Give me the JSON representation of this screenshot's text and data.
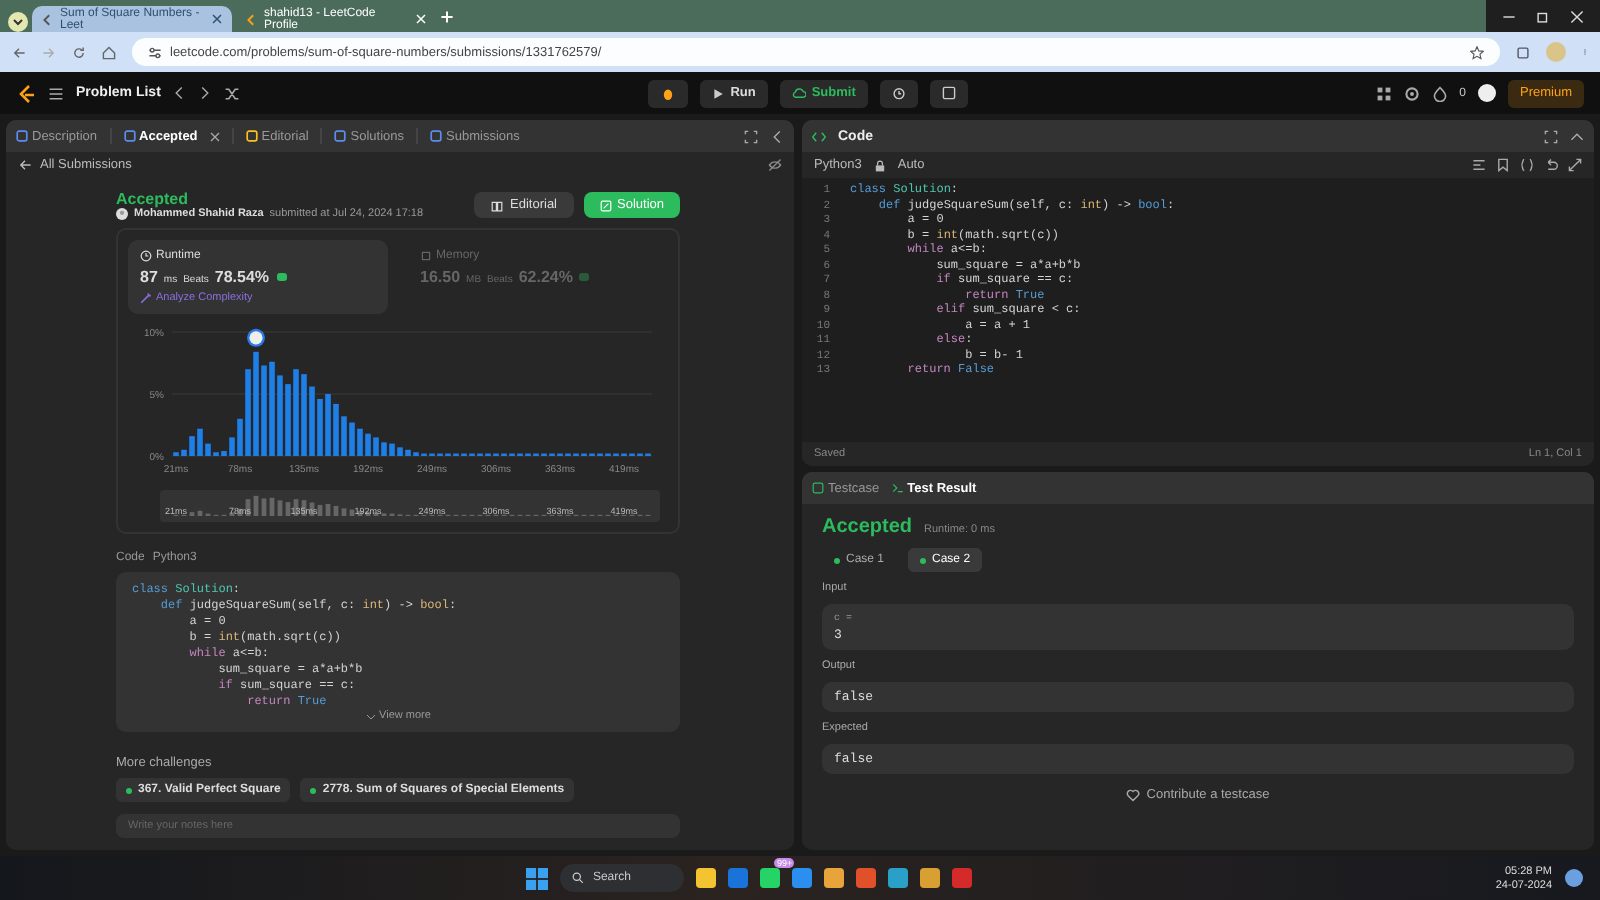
{
  "browser": {
    "tabs": [
      {
        "title": "Sum of Square Numbers - Leet",
        "selected": true
      },
      {
        "title": "shahid13 - LeetCode Profile",
        "selected": false
      }
    ],
    "url": "leetcode.com/problems/sum-of-square-numbers/submissions/1331762579/"
  },
  "navbar": {
    "problem_list": "Problem List",
    "run": "Run",
    "submit": "Submit",
    "streak": "0",
    "premium": "Premium"
  },
  "left_panel": {
    "tabs": [
      {
        "label": "Description",
        "selected": false,
        "closable": false
      },
      {
        "label": "Accepted",
        "selected": true,
        "closable": true
      },
      {
        "label": "Editorial",
        "selected": false,
        "closable": false
      },
      {
        "label": "Solutions",
        "selected": false,
        "closable": false
      },
      {
        "label": "Submissions",
        "selected": false,
        "closable": false
      }
    ],
    "back_link": "All Submissions",
    "status": "Accepted",
    "author": "Mohammed Shahid Raza",
    "submitted": "submitted at Jul 24, 2024 17:18",
    "buttons": [
      {
        "label": "Editorial",
        "kind": "secondary"
      },
      {
        "label": "Solution",
        "kind": "primary"
      }
    ],
    "stats": [
      {
        "title": "Runtime",
        "value": "87",
        "unit": "ms",
        "beats_label": "Beats",
        "beats": "78.54%",
        "selected": true
      },
      {
        "title": "Memory",
        "value": "16.50",
        "unit": "MB",
        "beats_label": "Beats",
        "beats": "62.24%",
        "selected": false
      }
    ],
    "analyze": "Analyze Complexity",
    "chart_data": {
      "type": "bar",
      "ylim": [
        0,
        10
      ],
      "yticks": [
        {
          "value": 0,
          "label": "0%"
        },
        {
          "value": 5,
          "label": "5%"
        },
        {
          "value": 10,
          "label": "10%"
        }
      ],
      "categories": [
        "21ms",
        null,
        null,
        null,
        null,
        null,
        null,
        null,
        "78ms",
        null,
        null,
        null,
        null,
        null,
        null,
        null,
        "135ms",
        null,
        null,
        null,
        null,
        null,
        null,
        null,
        "192ms",
        null,
        null,
        null,
        null,
        null,
        null,
        null,
        "249ms",
        null,
        null,
        null,
        null,
        null,
        null,
        null,
        "306ms",
        null,
        null,
        null,
        null,
        null,
        null,
        null,
        "363ms",
        null,
        null,
        null,
        null,
        null,
        null,
        null,
        "419ms",
        null,
        null,
        null
      ],
      "values": [
        0.3,
        0.5,
        1.6,
        2.2,
        1.0,
        0.3,
        0.4,
        1.5,
        3.0,
        7.0,
        8.4,
        7.3,
        7.6,
        6.5,
        5.8,
        7.0,
        6.6,
        5.6,
        4.6,
        5.0,
        4.2,
        3.2,
        2.7,
        2.2,
        1.8,
        1.5,
        1.1,
        1.0,
        0.7,
        0.5,
        0.3,
        0.2,
        0.2,
        0.2,
        0.2,
        0.2,
        0.2,
        0.2,
        0.2,
        0.2,
        0.2,
        0.2,
        0.2,
        0.2,
        0.2,
        0.2,
        0.2,
        0.2,
        0.2,
        0.2,
        0.2,
        0.2,
        0.2,
        0.2,
        0.2,
        0.2,
        0.2,
        0.2,
        0.2,
        0.2
      ]
    },
    "brush_labels": [
      "21ms",
      "78ms",
      "135ms",
      "192ms",
      "249ms",
      "306ms",
      "363ms",
      "419ms"
    ],
    "code_label": "Code",
    "code_lang": "Python3",
    "code_lines": [
      [
        {
          "text": "class",
          "kind": "kw"
        },
        {
          "text": " Solution",
          "kind": "cls"
        },
        {
          "text": ":",
          "kind": "p"
        }
      ],
      [
        {
          "text": "    def",
          "kind": "kw"
        },
        {
          "text": " judgeSquareSum(self, c: ",
          "kind": "p"
        },
        {
          "text": "int",
          "kind": "ty"
        },
        {
          "text": ") -> ",
          "kind": "p"
        },
        {
          "text": "bool",
          "kind": "ty"
        },
        {
          "text": ":",
          "kind": "p"
        }
      ],
      [
        {
          "text": "        a = 0",
          "kind": "p"
        }
      ],
      [
        {
          "text": "        b = ",
          "kind": "p"
        },
        {
          "text": "int",
          "kind": "ty"
        },
        {
          "text": "(math.sqrt(c))",
          "kind": "p"
        }
      ],
      [
        {
          "text": "        while",
          "kind": "ctl"
        },
        {
          "text": " a<=b:",
          "kind": "p"
        }
      ],
      [
        {
          "text": "            sum_square = a*a+b*b",
          "kind": "p"
        }
      ],
      [
        {
          "text": "            if",
          "kind": "ctl"
        },
        {
          "text": " sum_square == c:",
          "kind": "p"
        }
      ],
      [
        {
          "text": "                return ",
          "kind": "ctl"
        },
        {
          "text": "True",
          "kind": "kw"
        }
      ]
    ],
    "view_more": "View more",
    "more_challenges": "More challenges",
    "challenges": [
      "367. Valid Perfect Square",
      "2778. Sum of Squares of Special Elements"
    ],
    "notes_placeholder": "Write your notes here"
  },
  "editor": {
    "title": "Code",
    "language": "Python3",
    "mode": "Auto",
    "lines": [
      {
        "n": "1",
        "seg": [
          {
            "text": "class",
            "kind": "kw"
          },
          {
            "text": " Solution",
            "kind": "cls"
          },
          {
            "text": ":",
            "kind": "p"
          }
        ]
      },
      {
        "n": "2",
        "seg": [
          {
            "text": "    def",
            "kind": "kw"
          },
          {
            "text": " judgeSquareSum(self, c: ",
            "kind": "p"
          },
          {
            "text": "int",
            "kind": "ty"
          },
          {
            "text": ") -> ",
            "kind": "p"
          },
          {
            "text": "bool",
            "kind": "kw"
          },
          {
            "text": ":",
            "kind": "p"
          }
        ]
      },
      {
        "n": "3",
        "seg": [
          {
            "text": "        a = 0",
            "kind": "p"
          }
        ]
      },
      {
        "n": "4",
        "seg": [
          {
            "text": "        b = ",
            "kind": "p"
          },
          {
            "text": "int",
            "kind": "ty"
          },
          {
            "text": "(math.sqrt(c))",
            "kind": "p"
          }
        ]
      },
      {
        "n": "5",
        "seg": [
          {
            "text": "        while",
            "kind": "ctl"
          },
          {
            "text": " a<=b:",
            "kind": "p"
          }
        ]
      },
      {
        "n": "6",
        "seg": [
          {
            "text": "            sum_square = a*a+b*b",
            "kind": "p"
          }
        ]
      },
      {
        "n": "7",
        "seg": [
          {
            "text": "            if",
            "kind": "ctl"
          },
          {
            "text": " sum_square == c:",
            "kind": "p"
          }
        ]
      },
      {
        "n": "8",
        "seg": [
          {
            "text": "                return ",
            "kind": "ctl"
          },
          {
            "text": "True",
            "kind": "kw"
          }
        ]
      },
      {
        "n": "9",
        "seg": [
          {
            "text": "            elif",
            "kind": "ctl"
          },
          {
            "text": " sum_square < c:",
            "kind": "p"
          }
        ]
      },
      {
        "n": "10",
        "seg": [
          {
            "text": "                a = a + 1",
            "kind": "p"
          }
        ]
      },
      {
        "n": "11",
        "seg": [
          {
            "text": "            else",
            "kind": "ctl"
          },
          {
            "text": ":",
            "kind": "p"
          }
        ]
      },
      {
        "n": "12",
        "seg": [
          {
            "text": "                b = b- 1",
            "kind": "p"
          }
        ]
      },
      {
        "n": "13",
        "seg": [
          {
            "text": "        return ",
            "kind": "ctl"
          },
          {
            "text": "False",
            "kind": "kw"
          }
        ]
      }
    ],
    "saved": "Saved",
    "cursor": "Ln 1, Col 1"
  },
  "test_panel": {
    "tabs": [
      {
        "label": "Testcase",
        "selected": false
      },
      {
        "label": "Test Result",
        "selected": true
      }
    ],
    "result": "Accepted",
    "runtime": "Runtime: 0 ms",
    "cases": [
      {
        "label": "Case 1",
        "selected": false
      },
      {
        "label": "Case 2",
        "selected": true
      }
    ],
    "input": {
      "label": "Input",
      "name": "c =",
      "value": "3"
    },
    "output": {
      "label": "Output",
      "value": "false"
    },
    "expected": {
      "label": "Expected",
      "value": "false"
    },
    "contribute": "Contribute a testcase"
  },
  "taskbar": {
    "search": "Search",
    "badge": "99+",
    "time": "05:28 PM",
    "date": "24-07-2024"
  }
}
